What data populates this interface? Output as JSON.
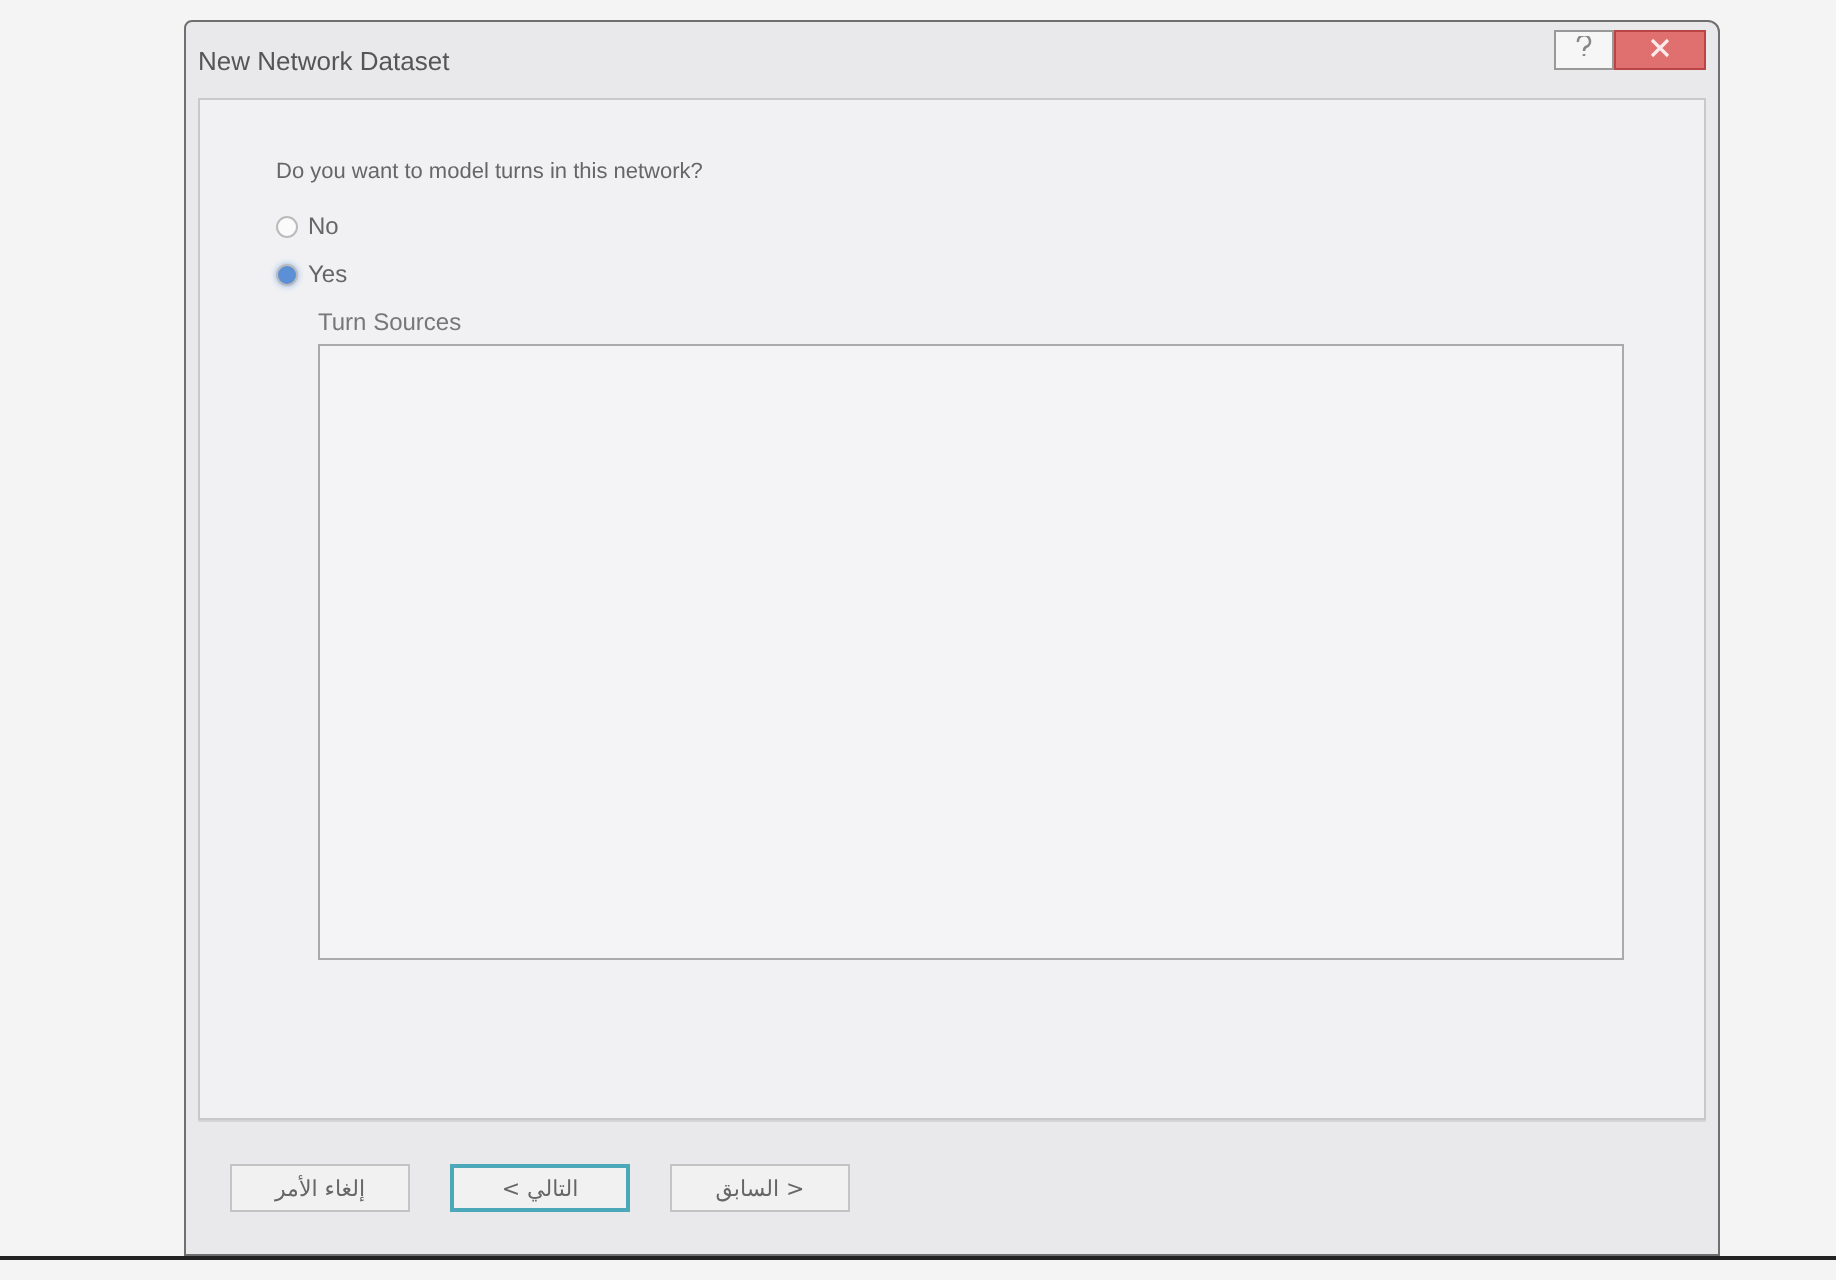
{
  "window": {
    "title": "New Network Dataset"
  },
  "question": "Do you want to model turns in this network?",
  "options": [
    {
      "label": "No",
      "selected": false
    },
    {
      "label": "Yes",
      "selected": true
    }
  ],
  "turn_sources": {
    "label": "Turn Sources"
  },
  "buttons": [
    {
      "label": "< السابق",
      "focused": false
    },
    {
      "label": "التالي >",
      "focused": true
    },
    {
      "label": "إلغاء الأمر",
      "focused": false
    }
  ]
}
